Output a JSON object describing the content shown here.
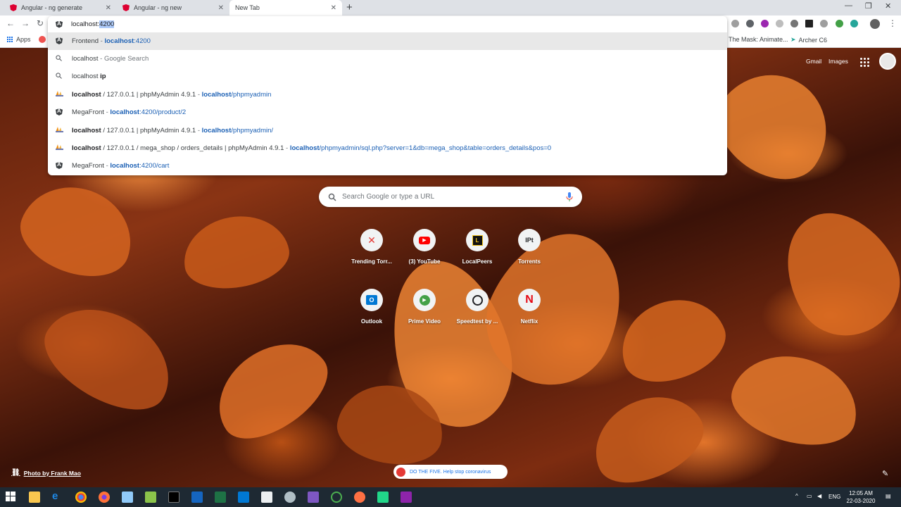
{
  "tabs": [
    {
      "title": "Angular - ng generate",
      "active": false
    },
    {
      "title": "Angular - ng new",
      "active": false
    },
    {
      "title": "New Tab",
      "active": true
    }
  ],
  "omnibox": {
    "typed": "localhost:",
    "autocomplete": "4200"
  },
  "suggestions": [
    {
      "icon": "angular-icon",
      "pre": "Frontend",
      "sep": " - ",
      "url_bold": "localhost",
      "url_rest": ":4200",
      "highlighted": true
    },
    {
      "icon": "search-icon",
      "bold": "localhost",
      "rest": " - Google Search"
    },
    {
      "icon": "search-icon",
      "plain": "localhost ",
      "bold": "ip"
    },
    {
      "icon": "phpmyadmin-icon",
      "bold": "localhost",
      "rest": " / 127.0.0.1 | phpMyAdmin 4.9.1",
      "sep": " - ",
      "url_bold": "localhost",
      "url_rest": "/phpmyadmin"
    },
    {
      "icon": "angular-icon",
      "pre": "MegaFront",
      "sep": " - ",
      "url_bold": "localhost",
      "url_rest": ":4200/product/2"
    },
    {
      "icon": "phpmyadmin-icon",
      "bold": "localhost",
      "rest": " / 127.0.0.1 | phpMyAdmin 4.9.1",
      "sep": " - ",
      "url_bold": "localhost",
      "url_rest": "/phpmyadmin/"
    },
    {
      "icon": "phpmyadmin-icon",
      "bold": "localhost",
      "rest": " / 127.0.0.1 / mega_shop / orders_details | phpMyAdmin 4.9.1",
      "sep": " - ",
      "url_bold": "localhost",
      "url_rest": "/phpmyadmin/sql.php?server=1&db=mega_shop&table=orders_details&pos=0"
    },
    {
      "icon": "angular-icon",
      "pre": "MegaFront",
      "sep": " - ",
      "url_bold": "localhost",
      "url_rest": ":4200/cart"
    }
  ],
  "bookmarks": {
    "apps": "Apps",
    "right": [
      "The Mask: Animate...",
      "Archer C6"
    ]
  },
  "ntp": {
    "gmail": "Gmail",
    "images": "Images",
    "search_placeholder": "Search Google or type a URL",
    "shortcuts_row1": [
      {
        "label": "Trending Torr...",
        "glyph": "X",
        "color": "#e53935"
      },
      {
        "label": "(3) YouTube",
        "glyph": "▶",
        "color": "#ff0000"
      },
      {
        "label": "LocalPeers",
        "glyph": "L",
        "color": "#000000"
      },
      {
        "label": "Torrents",
        "glyph": "IPt",
        "color": "#202124"
      }
    ],
    "shortcuts_row2": [
      {
        "label": "Outlook",
        "glyph": "O",
        "color": "#0078d4"
      },
      {
        "label": "Prime Video",
        "glyph": "▶",
        "color": "#43a047"
      },
      {
        "label": "Speedtest by ...",
        "glyph": "◔",
        "color": "#202124"
      },
      {
        "label": "Netflix",
        "glyph": "N",
        "color": "#e50914"
      }
    ],
    "photo_credit": "Photo by Frank Mao",
    "promo": "DO THE FIVE. Help stop coronavirus"
  },
  "taskbar": {
    "language": "ENG",
    "time": "12:05 AM",
    "date": "22-03-2020"
  }
}
